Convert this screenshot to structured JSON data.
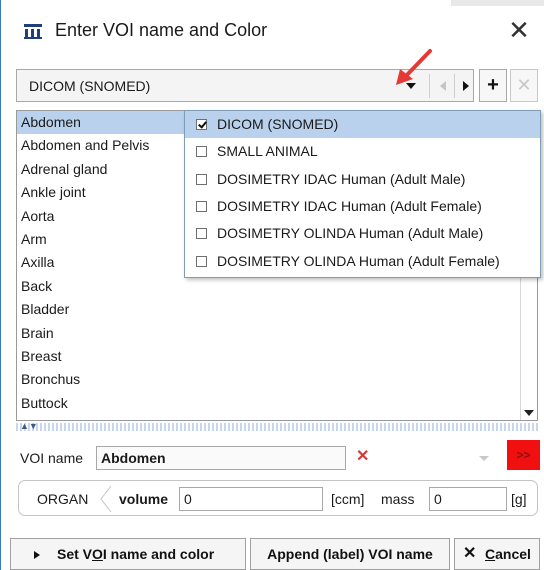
{
  "dialog": {
    "title": "Enter VOI name and Color",
    "close_glyph": "✕"
  },
  "combo": {
    "selected": "DICOM (SNOMED)",
    "plus_label": "+",
    "remove_label": "✕"
  },
  "list": {
    "items": [
      "Abdomen",
      "Abdomen and Pelvis",
      "Adrenal gland",
      "Ankle joint",
      "Aorta",
      "Arm",
      "Axilla",
      "Back",
      "Bladder",
      "Brain",
      "Breast",
      "Bronchus",
      "Buttock"
    ],
    "selected_index": 0
  },
  "dropdown": {
    "options": [
      {
        "label": "DICOM (SNOMED)",
        "checked": true
      },
      {
        "label": "SMALL ANIMAL",
        "checked": false
      },
      {
        "label": "DOSIMETRY IDAC Human (Adult Male)",
        "checked": false
      },
      {
        "label": "DOSIMETRY IDAC Human (Adult Female)",
        "checked": false
      },
      {
        "label": "DOSIMETRY OLINDA Human (Adult Male)",
        "checked": false
      },
      {
        "label": "DOSIMETRY OLINDA Human (Adult Female)",
        "checked": false
      }
    ]
  },
  "voi": {
    "label": "VOI name",
    "value": "Abdomen",
    "clear_glyph": "✕",
    "color_button_label": ">>",
    "color": "#f01010"
  },
  "organ": {
    "label": "ORGAN",
    "volume_label": "volume",
    "volume_value": "0",
    "volume_unit": "[ccm]",
    "mass_label": "mass",
    "mass_value": "0",
    "mass_unit": "[g]"
  },
  "buttons": {
    "set_pre": "Set V",
    "set_u": "O",
    "set_post": "I name and color",
    "append": "Append (label) VOI name",
    "cancel_u": "C",
    "cancel_post": "ancel",
    "cancel_glyph": "✕"
  },
  "icons": {
    "app": "pmod-app-icon",
    "close": "close-icon",
    "dropdown": "triangle-down-icon",
    "prev": "triangle-left-icon",
    "next": "triangle-right-icon",
    "annotation": "red-arrow-annotation"
  },
  "colors": {
    "selection": "#b9d1ec",
    "accent_border": "#3c79c8",
    "annotation_arrow": "#e53935",
    "color_swatch": "#f01010"
  }
}
